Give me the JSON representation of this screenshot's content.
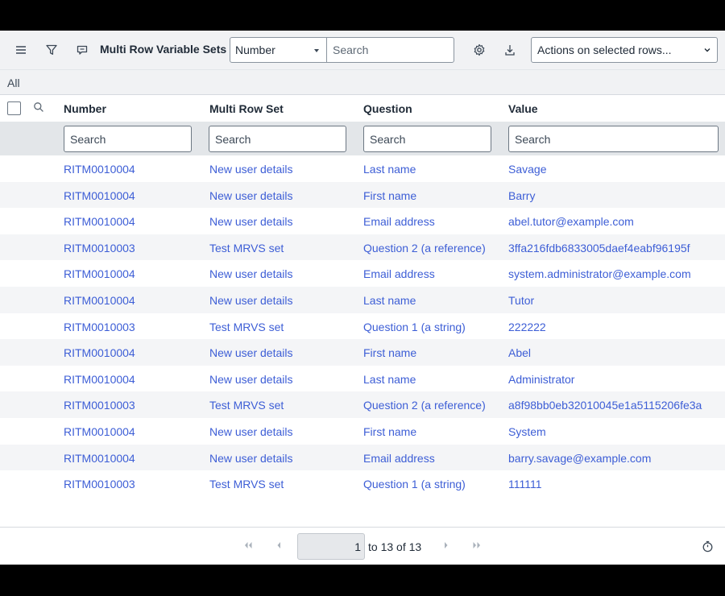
{
  "toolbar": {
    "title": "Multi Row Variable Sets",
    "field_value": "Number",
    "search_placeholder": "Search",
    "actions_label": "Actions on selected rows..."
  },
  "breadcrumb": {
    "label": "All"
  },
  "columns": [
    "Number",
    "Multi Row Set",
    "Question",
    "Value"
  ],
  "filters": {
    "placeholder": "Search"
  },
  "rows": [
    {
      "number": "RITM0010004",
      "set": "New user details",
      "question": "Last name",
      "value": "Savage"
    },
    {
      "number": "RITM0010004",
      "set": "New user details",
      "question": "First name",
      "value": "Barry"
    },
    {
      "number": "RITM0010004",
      "set": "New user details",
      "question": "Email address",
      "value": "abel.tutor@example.com"
    },
    {
      "number": "RITM0010003",
      "set": "Test MRVS set",
      "question": "Question 2 (a reference)",
      "value": "3ffa216fdb6833005daef4eabf96195f"
    },
    {
      "number": "RITM0010004",
      "set": "New user details",
      "question": "Email address",
      "value": "system.administrator@example.com"
    },
    {
      "number": "RITM0010004",
      "set": "New user details",
      "question": "Last name",
      "value": "Tutor"
    },
    {
      "number": "RITM0010003",
      "set": "Test MRVS set",
      "question": "Question 1 (a string)",
      "value": "222222"
    },
    {
      "number": "RITM0010004",
      "set": "New user details",
      "question": "First name",
      "value": "Abel"
    },
    {
      "number": "RITM0010004",
      "set": "New user details",
      "question": "Last name",
      "value": "Administrator"
    },
    {
      "number": "RITM0010003",
      "set": "Test MRVS set",
      "question": "Question 2 (a reference)",
      "value": "a8f98bb0eb32010045e1a5115206fe3a"
    },
    {
      "number": "RITM0010004",
      "set": "New user details",
      "question": "First name",
      "value": "System"
    },
    {
      "number": "RITM0010004",
      "set": "New user details",
      "question": "Email address",
      "value": "barry.savage@example.com"
    },
    {
      "number": "RITM0010003",
      "set": "Test MRVS set",
      "question": "Question 1 (a string)",
      "value": "111111"
    }
  ],
  "pagination": {
    "page": "1",
    "range_text": "to 13 of 13"
  },
  "icons": {
    "menu": "hamburger-icon",
    "filter": "filter-icon",
    "context": "context-menu-icon",
    "settings": "gear-icon",
    "export": "download-icon",
    "search": "search-icon",
    "timer": "stopwatch-icon"
  },
  "colors": {
    "link": "#3d5ed6",
    "toolbar_bg": "#f1f2f4",
    "stripe": "#f4f5f7"
  }
}
